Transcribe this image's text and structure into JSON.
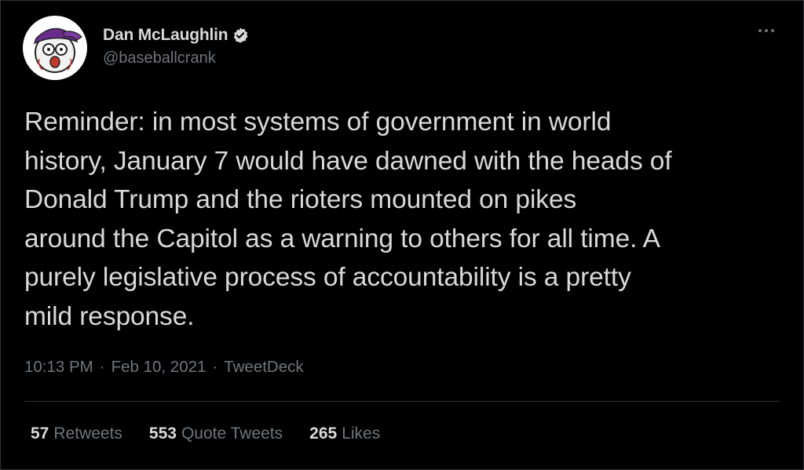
{
  "tweet": {
    "author": {
      "display_name": "Dan McLaughlin",
      "handle": "@baseballcrank",
      "verified": true,
      "avatar_icon": "cartoon-baseball-face-avatar"
    },
    "more_icon": "more-dots-icon",
    "text": "Reminder: in most systems of government in world\nhistory, January 7 would have dawned with the heads of\nDonald Trump and the rioters mounted on pikes\naround the Capitol as a warning to others for all time. A\npurely legislative process of accountability is a pretty\nmild response.",
    "time": "10:13 PM",
    "separator": "·",
    "date": "Feb 10, 2021",
    "source": "TweetDeck",
    "stats": {
      "retweets_count": "57",
      "retweets_label": "Retweets",
      "quote_tweets_count": "553",
      "quote_tweets_label": "Quote Tweets",
      "likes_count": "265",
      "likes_label": "Likes"
    }
  },
  "colors": {
    "background": "#000000",
    "text_primary": "#d9d9d9",
    "text_secondary": "#6e767d",
    "divider": "#2f3336",
    "verified_badge": "#d9d9d9"
  }
}
